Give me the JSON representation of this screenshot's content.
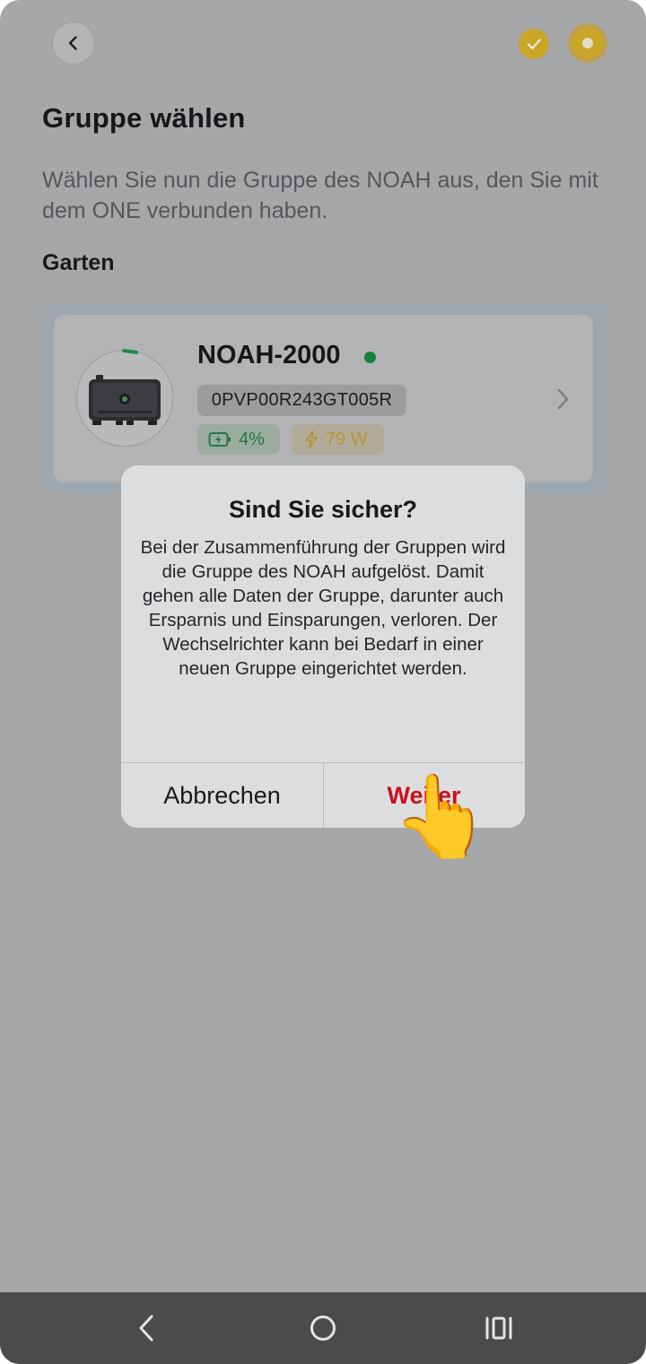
{
  "header": {
    "back_icon": "chevron-left-icon",
    "step_done_icon": "check-icon",
    "step_current_icon": "dot-icon",
    "accent_color": "#c9a528"
  },
  "page": {
    "title": "Gruppe wählen",
    "description": "Wählen Sie nun die Gruppe des NOAH aus, den Sie mit dem ONE verbunden haben.",
    "group_label": "Garten"
  },
  "device": {
    "name": "NOAH-2000",
    "status_color": "#16813d",
    "serial": "0PVP00R243GT005R",
    "battery": "4%",
    "power": "79 W"
  },
  "dialog": {
    "title": "Sind Sie sicher?",
    "message": "Bei der Zusammenführung der Gruppen wird die Gruppe des NOAH aufgelöst. Damit gehen alle Daten der Gruppe, darunter auch Ersparnis und Einsparungen, verloren. Der Wechselrichter kann bei Bedarf in einer neuen Gruppe eingerichtet werden.",
    "cancel_label": "Abbrechen",
    "continue_label": "Weiter",
    "continue_color": "#c8101b"
  },
  "pointer": {
    "glyph": "👆"
  },
  "navbar": {
    "back_icon": "nav-back-icon",
    "home_icon": "nav-home-icon",
    "recents_icon": "nav-recents-icon"
  }
}
